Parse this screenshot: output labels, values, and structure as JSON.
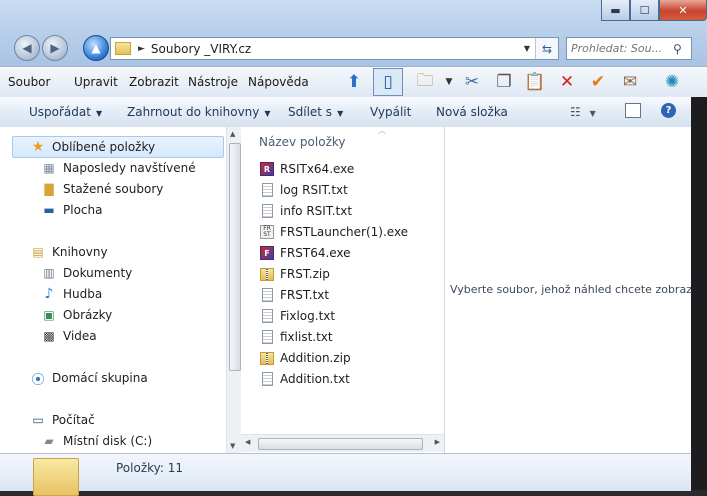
{
  "window": {
    "caption": {
      "min": "▬",
      "max": "☐",
      "close": "✕"
    }
  },
  "address": {
    "path": "Soubory _VIRY.cz",
    "separator": "►"
  },
  "search": {
    "placeholder": "Prohledat: Sou..."
  },
  "menubar": {
    "items": [
      "Soubor",
      "Upravit",
      "Zobrazit",
      "Nástroje",
      "Nápověda"
    ]
  },
  "commandbar": {
    "organize": "Uspořádat",
    "add_to_library": "Zahrnout do knihovny",
    "share": "Sdílet s",
    "burn": "Vypálit",
    "new_folder": "Nová složka"
  },
  "navpane": {
    "favorites": "Oblíbené položky",
    "recent": "Naposledy navštívené",
    "downloads": "Stažené soubory",
    "desktop": "Plocha",
    "libraries": "Knihovny",
    "documents": "Dokumenty",
    "music": "Hudba",
    "pictures": "Obrázky",
    "videos": "Videa",
    "homegroup": "Domácí skupina",
    "computer": "Počítač",
    "local_disk": "Místní disk (C:)"
  },
  "filelist": {
    "column_header": "Název položky",
    "files": [
      {
        "name": "RSITx64.exe",
        "icon": "rsit-exe-icon"
      },
      {
        "name": "log RSIT.txt",
        "icon": "text-file-icon"
      },
      {
        "name": "info RSIT.txt",
        "icon": "text-file-icon"
      },
      {
        "name": "FRSTLauncher(1).exe",
        "icon": "frst-launcher-icon"
      },
      {
        "name": "FRST64.exe",
        "icon": "frst-exe-icon"
      },
      {
        "name": "FRST.zip",
        "icon": "zip-file-icon"
      },
      {
        "name": "FRST.txt",
        "icon": "text-file-icon"
      },
      {
        "name": "Fixlog.txt",
        "icon": "text-file-icon"
      },
      {
        "name": "fixlist.txt",
        "icon": "text-file-icon"
      },
      {
        "name": "Addition.zip",
        "icon": "zip-file-icon"
      },
      {
        "name": "Addition.txt",
        "icon": "text-file-icon"
      }
    ]
  },
  "preview": {
    "message": "Vyberte soubor, jehož náhled chcete zobrazit."
  },
  "details": {
    "count": "Položky: 11"
  },
  "colors": {
    "accent": "#1e395b",
    "selection": "#d6e8fb",
    "chrome": "#b9d0ea"
  }
}
